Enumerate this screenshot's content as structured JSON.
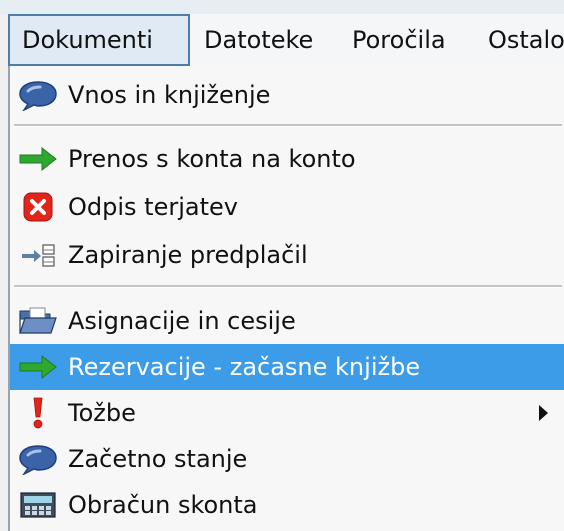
{
  "menubar": {
    "items": [
      {
        "label": "Dokumenti",
        "active": true
      },
      {
        "label": "Datoteke"
      },
      {
        "label": "Poročila"
      },
      {
        "label": "Ostalo"
      }
    ]
  },
  "dropdown": {
    "items": [
      {
        "label": "Vnos in knjiženje",
        "icon": "speech-bubble-icon"
      },
      {
        "label": "Prenos s konta na konto",
        "icon": "green-arrow-icon"
      },
      {
        "label": "Odpis terjatev",
        "icon": "red-x-icon"
      },
      {
        "label": "Zapiranje predplačil",
        "icon": "document-transfer-icon"
      },
      {
        "label": "Asignacije in cesije",
        "icon": "open-folder-icon"
      },
      {
        "label": "Rezervacije - začasne knjižbe",
        "icon": "green-arrow-icon",
        "highlighted": true
      },
      {
        "label": "Tožbe",
        "icon": "exclamation-icon",
        "submenu": true
      },
      {
        "label": "Začetno stanje",
        "icon": "speech-bubble-icon"
      },
      {
        "label": "Obračun skonta",
        "icon": "calculator-icon"
      }
    ]
  },
  "colors": {
    "highlight": "#3d9ce7",
    "active_menu_border": "#4e7ea8",
    "arrow_green": "#2fa82f",
    "error_red": "#e0261b"
  }
}
